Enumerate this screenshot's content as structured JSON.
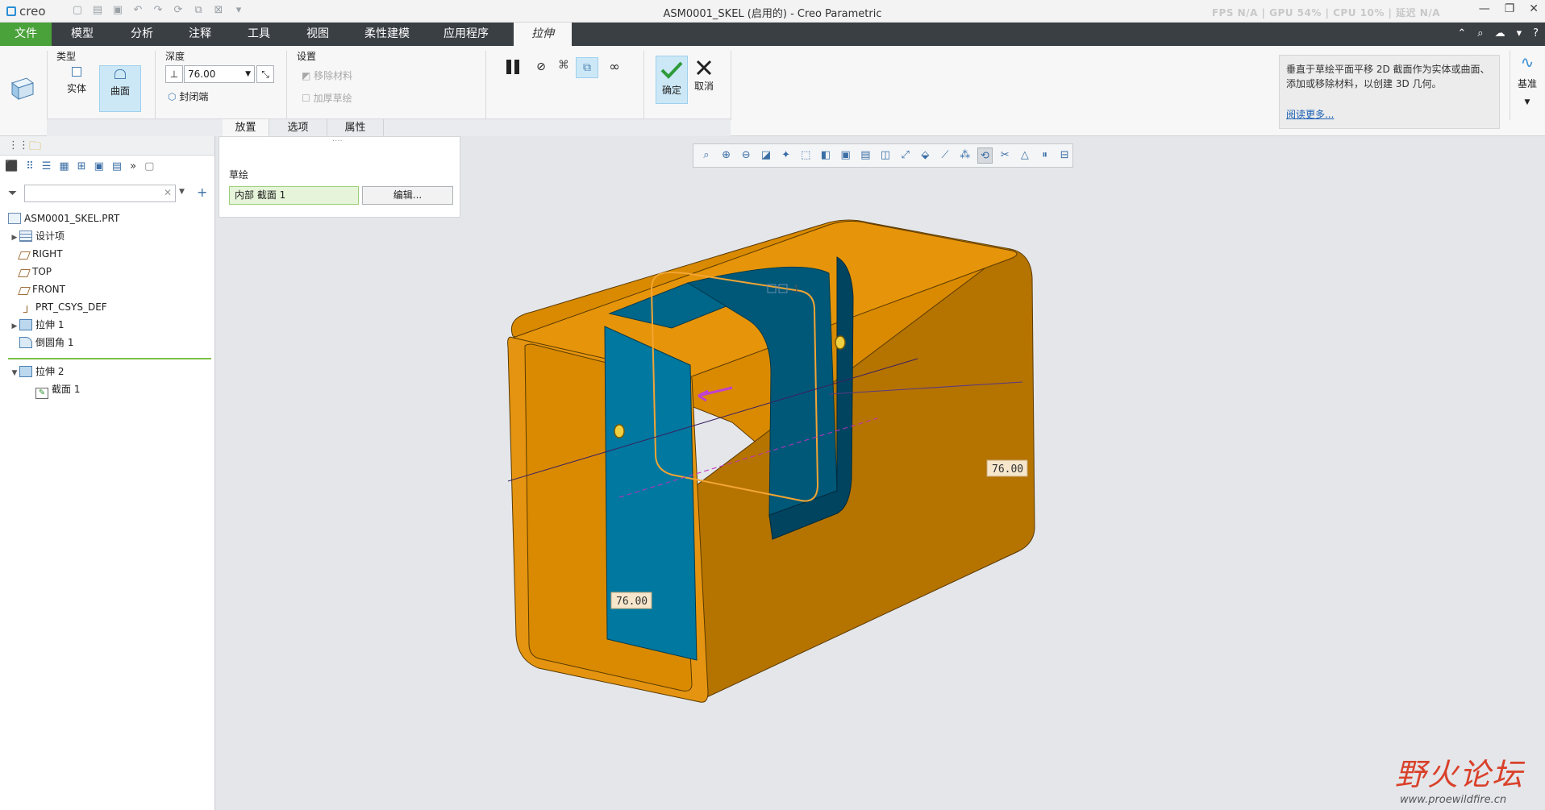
{
  "titlebar": {
    "logo": "creo",
    "title": "ASM0001_SKEL (启用的) - Creo Parametric",
    "perf": "FPS N/A  |  GPU 54%  |  CPU 10%  |  延迟 N/A"
  },
  "ribbon_tabs": {
    "file": "文件",
    "model": "模型",
    "analysis": "分析",
    "annotate": "注释",
    "tools": "工具",
    "view": "视图",
    "flexible": "柔性建模",
    "applications": "应用程序",
    "extrude": "拉伸"
  },
  "ribbon": {
    "type_label": "类型",
    "solid": "实体",
    "surface": "曲面",
    "depth_label": "深度",
    "depth_value": "76.00",
    "capped_ends": "封闭端",
    "settings_label": "设置",
    "remove_material": "移除材料",
    "thicken_sketch": "加厚草绘",
    "ok": "确定",
    "cancel": "取消",
    "help_text": "垂直于草绘平面平移 2D 截面作为实体或曲面、添加或移除材料，以创建 3D 几何。",
    "read_more": "阅读更多...",
    "datum": "基准"
  },
  "subtabs": {
    "placement": "放置",
    "options": "选项",
    "properties": "属性"
  },
  "placement_panel": {
    "sketch_label": "草绘",
    "collector": "内部 截面 1",
    "edit_button": "编辑..."
  },
  "model_tree": {
    "root": "ASM0001_SKEL.PRT",
    "items": [
      {
        "label": "设计项"
      },
      {
        "label": "RIGHT"
      },
      {
        "label": "TOP"
      },
      {
        "label": "FRONT"
      },
      {
        "label": "PRT_CSYS_DEF"
      },
      {
        "label": "拉伸 1"
      },
      {
        "label": "倒圆角 1"
      },
      {
        "label": "拉伸 2"
      },
      {
        "label": "截面 1"
      }
    ]
  },
  "viewport": {
    "dim_right": "76.00",
    "dim_left": "76.00",
    "sketch_tag": "1"
  },
  "watermark": {
    "text": "野火论坛",
    "url": "www.proewildfire.cn"
  },
  "colors": {
    "body": "#d98a00",
    "section": "#006f8f",
    "section_dark": "#00485f",
    "sketch": "#f2a533",
    "ribbon_dark": "#3a3f44",
    "file_green": "#4aa23a"
  }
}
